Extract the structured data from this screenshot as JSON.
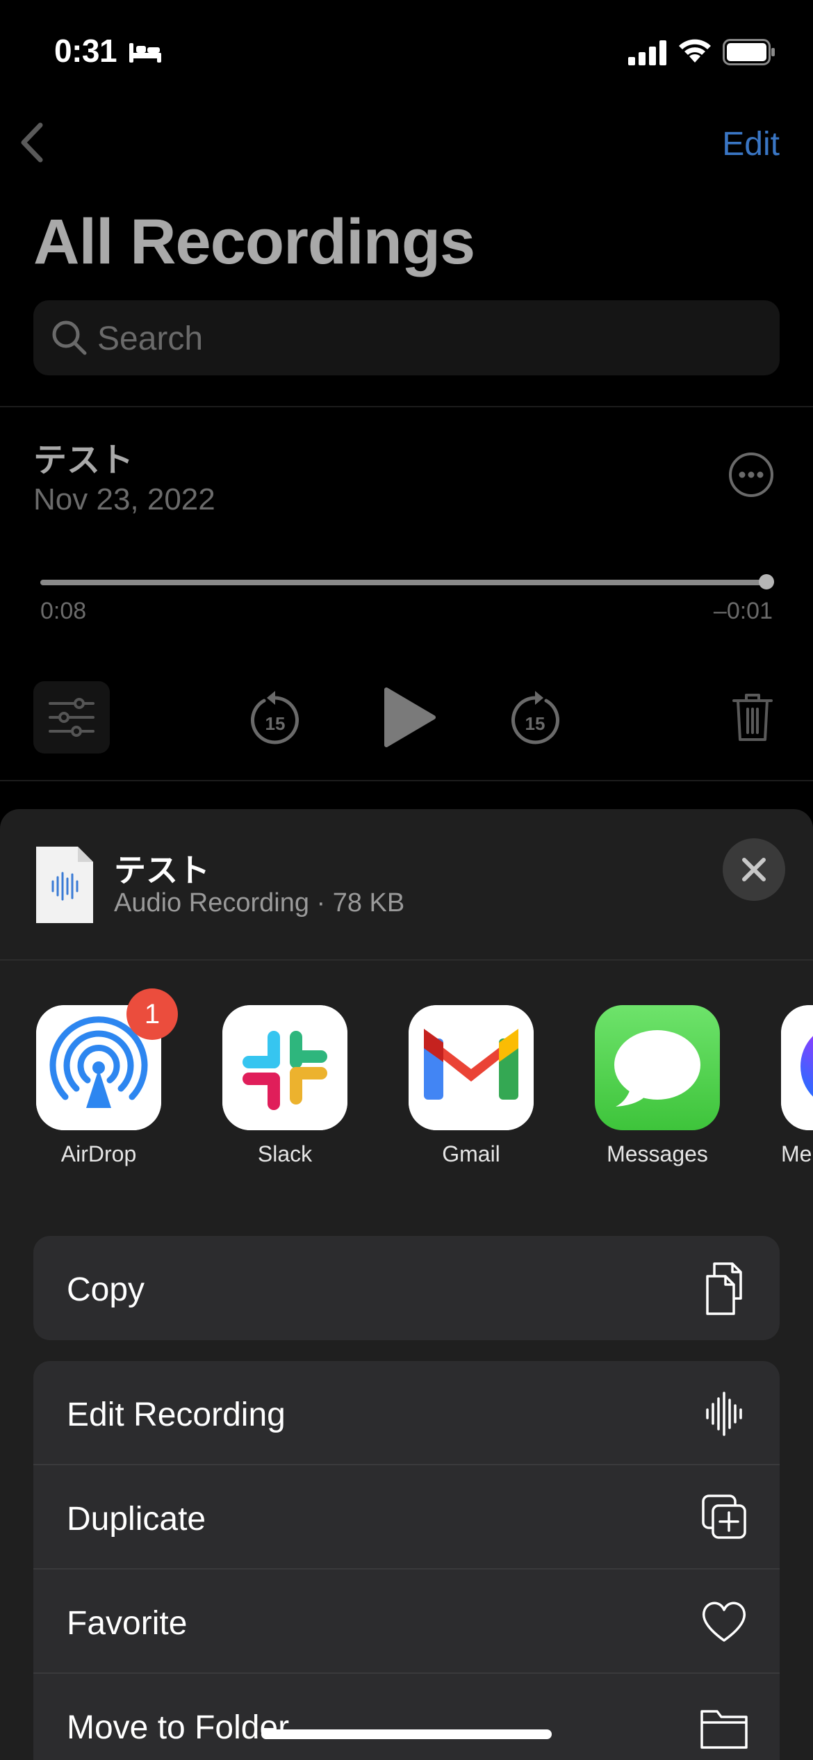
{
  "status_bar": {
    "time": "0:31",
    "icons": [
      "bed-icon",
      "cellular-signal-icon",
      "wifi-icon",
      "battery-icon"
    ]
  },
  "nav": {
    "back_icon": "chevron-left-icon",
    "edit_label": "Edit",
    "title": "All Recordings"
  },
  "search": {
    "placeholder": "Search",
    "icon": "search-icon"
  },
  "recording": {
    "title": "テスト",
    "date": "Nov 23, 2022",
    "elapsed": "0:08",
    "remaining": "–0:01",
    "progress_fraction": 0.99,
    "skip_back_seconds": "15",
    "skip_forward_seconds": "15"
  },
  "share_sheet": {
    "file_name": "テスト",
    "file_meta": "Audio Recording · 78 KB",
    "apps": [
      {
        "label": "AirDrop",
        "icon": "airdrop-icon",
        "badge": "1"
      },
      {
        "label": "Slack",
        "icon": "slack-icon"
      },
      {
        "label": "Gmail",
        "icon": "gmail-icon"
      },
      {
        "label": "Messages",
        "icon": "messages-icon"
      },
      {
        "label": "Me",
        "icon": "messenger-icon"
      }
    ],
    "actions_group1": [
      {
        "label": "Copy",
        "icon": "copy-icon"
      }
    ],
    "actions_group2": [
      {
        "label": "Edit Recording",
        "icon": "waveform-icon"
      },
      {
        "label": "Duplicate",
        "icon": "duplicate-icon"
      },
      {
        "label": "Favorite",
        "icon": "heart-icon"
      },
      {
        "label": "Move to Folder",
        "icon": "folder-icon"
      }
    ]
  },
  "colors": {
    "accent": "#3a76c4",
    "sheet_bg": "#1f1f1f",
    "row_bg": "#2c2c2e",
    "badge": "#eb4d3d"
  }
}
